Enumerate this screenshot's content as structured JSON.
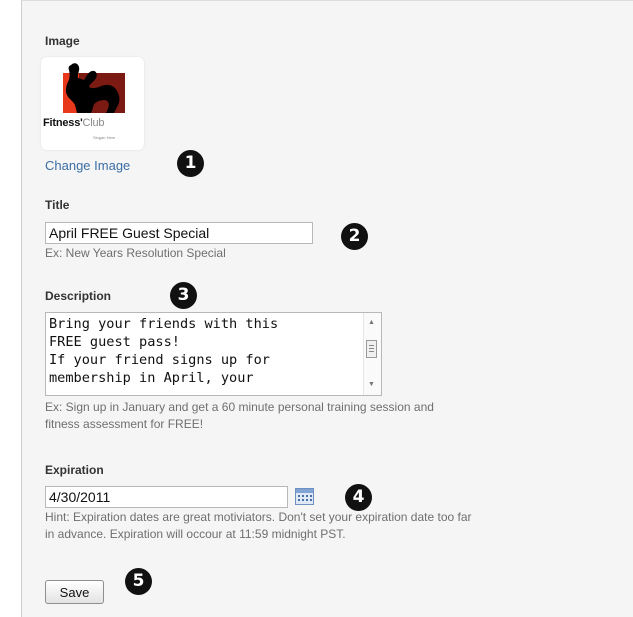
{
  "image_section": {
    "label": "Image",
    "logo_text_main": "Fitness'",
    "logo_text_accent": "Club",
    "logo_tagline": "Slogan Here",
    "change_link": "Change Image"
  },
  "title_section": {
    "label": "Title",
    "value": "April FREE Guest Special",
    "example": "Ex: New Years Resolution Special"
  },
  "description_section": {
    "label": "Description",
    "value": "Bring your friends with this\nFREE guest pass!\nIf your friend signs up for\nmembership in April, your",
    "example_line1": "Ex: Sign up in January and get a 60 minute personal training session and",
    "example_line2": "fitness assessment for FREE!"
  },
  "expiration_section": {
    "label": "Expiration",
    "value": "4/30/2011",
    "hint_line1": "Hint: Expiration dates are great motiviators. Don't set your expiration date too far",
    "hint_line2": "in advance. Expiration will occour at 11:59 midnight PST."
  },
  "save_label": "Save",
  "callouts": [
    "1",
    "2",
    "3",
    "4",
    "5"
  ],
  "colors": {
    "link": "#3b6ea5",
    "callout": "#111111",
    "panel": "#f5f5f5"
  }
}
